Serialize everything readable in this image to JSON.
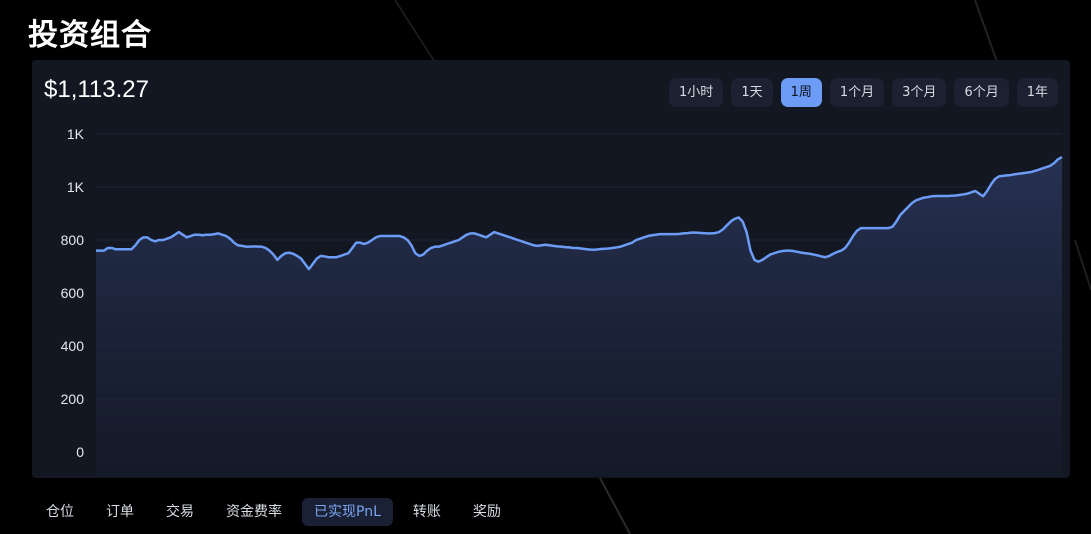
{
  "page": {
    "title": "投资组合"
  },
  "portfolio": {
    "balance": "$1,113.27"
  },
  "time_ranges": [
    {
      "label": "1小时",
      "active": false
    },
    {
      "label": "1天",
      "active": false
    },
    {
      "label": "1周",
      "active": true
    },
    {
      "label": "1个月",
      "active": false
    },
    {
      "label": "3个月",
      "active": false
    },
    {
      "label": "6个月",
      "active": false
    },
    {
      "label": "1年",
      "active": false
    }
  ],
  "tabs": [
    {
      "label": "仓位",
      "active": false
    },
    {
      "label": "订单",
      "active": false
    },
    {
      "label": "交易",
      "active": false
    },
    {
      "label": "资金费率",
      "active": false
    },
    {
      "label": "已实现PnL",
      "active": true
    },
    {
      "label": "转账",
      "active": false
    },
    {
      "label": "奖励",
      "active": false
    }
  ],
  "colors": {
    "line": "#6c9cf5",
    "card": "#121722",
    "active_tab_text": "#7aa5f2"
  },
  "chart_data": {
    "type": "area",
    "ytick_labels": [
      "1K",
      "1K",
      "800",
      "600",
      "400",
      "200",
      "0"
    ],
    "ytick_values": [
      1200,
      1000,
      800,
      600,
      400,
      200,
      0
    ],
    "ylim": [
      0,
      1200
    ],
    "grid": true,
    "values": [
      760,
      760,
      760,
      770,
      770,
      765,
      765,
      765,
      765,
      765,
      780,
      800,
      810,
      810,
      800,
      795,
      800,
      800,
      805,
      810,
      820,
      830,
      820,
      810,
      815,
      820,
      820,
      818,
      820,
      820,
      822,
      825,
      820,
      815,
      805,
      790,
      780,
      778,
      775,
      775,
      776,
      775,
      775,
      770,
      760,
      745,
      725,
      740,
      750,
      752,
      748,
      740,
      730,
      710,
      690,
      710,
      730,
      740,
      738,
      735,
      735,
      735,
      740,
      745,
      750,
      770,
      790,
      790,
      785,
      790,
      800,
      810,
      815,
      815,
      815,
      815,
      815,
      815,
      810,
      800,
      780,
      750,
      740,
      745,
      760,
      770,
      775,
      775,
      780,
      785,
      790,
      795,
      800,
      810,
      820,
      825,
      825,
      820,
      815,
      810,
      820,
      830,
      825,
      820,
      815,
      810,
      805,
      800,
      795,
      790,
      785,
      780,
      778,
      780,
      782,
      780,
      778,
      776,
      775,
      773,
      772,
      770,
      770,
      768,
      766,
      764,
      763,
      764,
      766,
      767,
      768,
      770,
      772,
      775,
      780,
      785,
      790,
      800,
      805,
      810,
      815,
      818,
      820,
      822,
      822,
      822,
      822,
      822,
      823,
      825,
      826,
      828,
      828,
      827,
      826,
      825,
      825,
      826,
      830,
      840,
      855,
      870,
      880,
      885,
      870,
      830,
      760,
      725,
      718,
      725,
      735,
      745,
      750,
      755,
      758,
      760,
      760,
      758,
      755,
      752,
      750,
      748,
      745,
      742,
      738,
      735,
      740,
      748,
      755,
      760,
      770,
      790,
      815,
      835,
      845,
      845,
      845,
      845,
      845,
      845,
      845,
      845,
      850,
      870,
      895,
      910,
      925,
      940,
      950,
      955,
      960,
      962,
      965,
      966,
      966,
      966,
      966,
      967,
      968,
      970,
      972,
      975,
      980,
      985,
      975,
      965,
      985,
      1010,
      1030,
      1040,
      1042,
      1044,
      1045,
      1048,
      1050,
      1052,
      1054,
      1056,
      1060,
      1065,
      1070,
      1075,
      1080,
      1090,
      1105,
      1113
    ]
  }
}
